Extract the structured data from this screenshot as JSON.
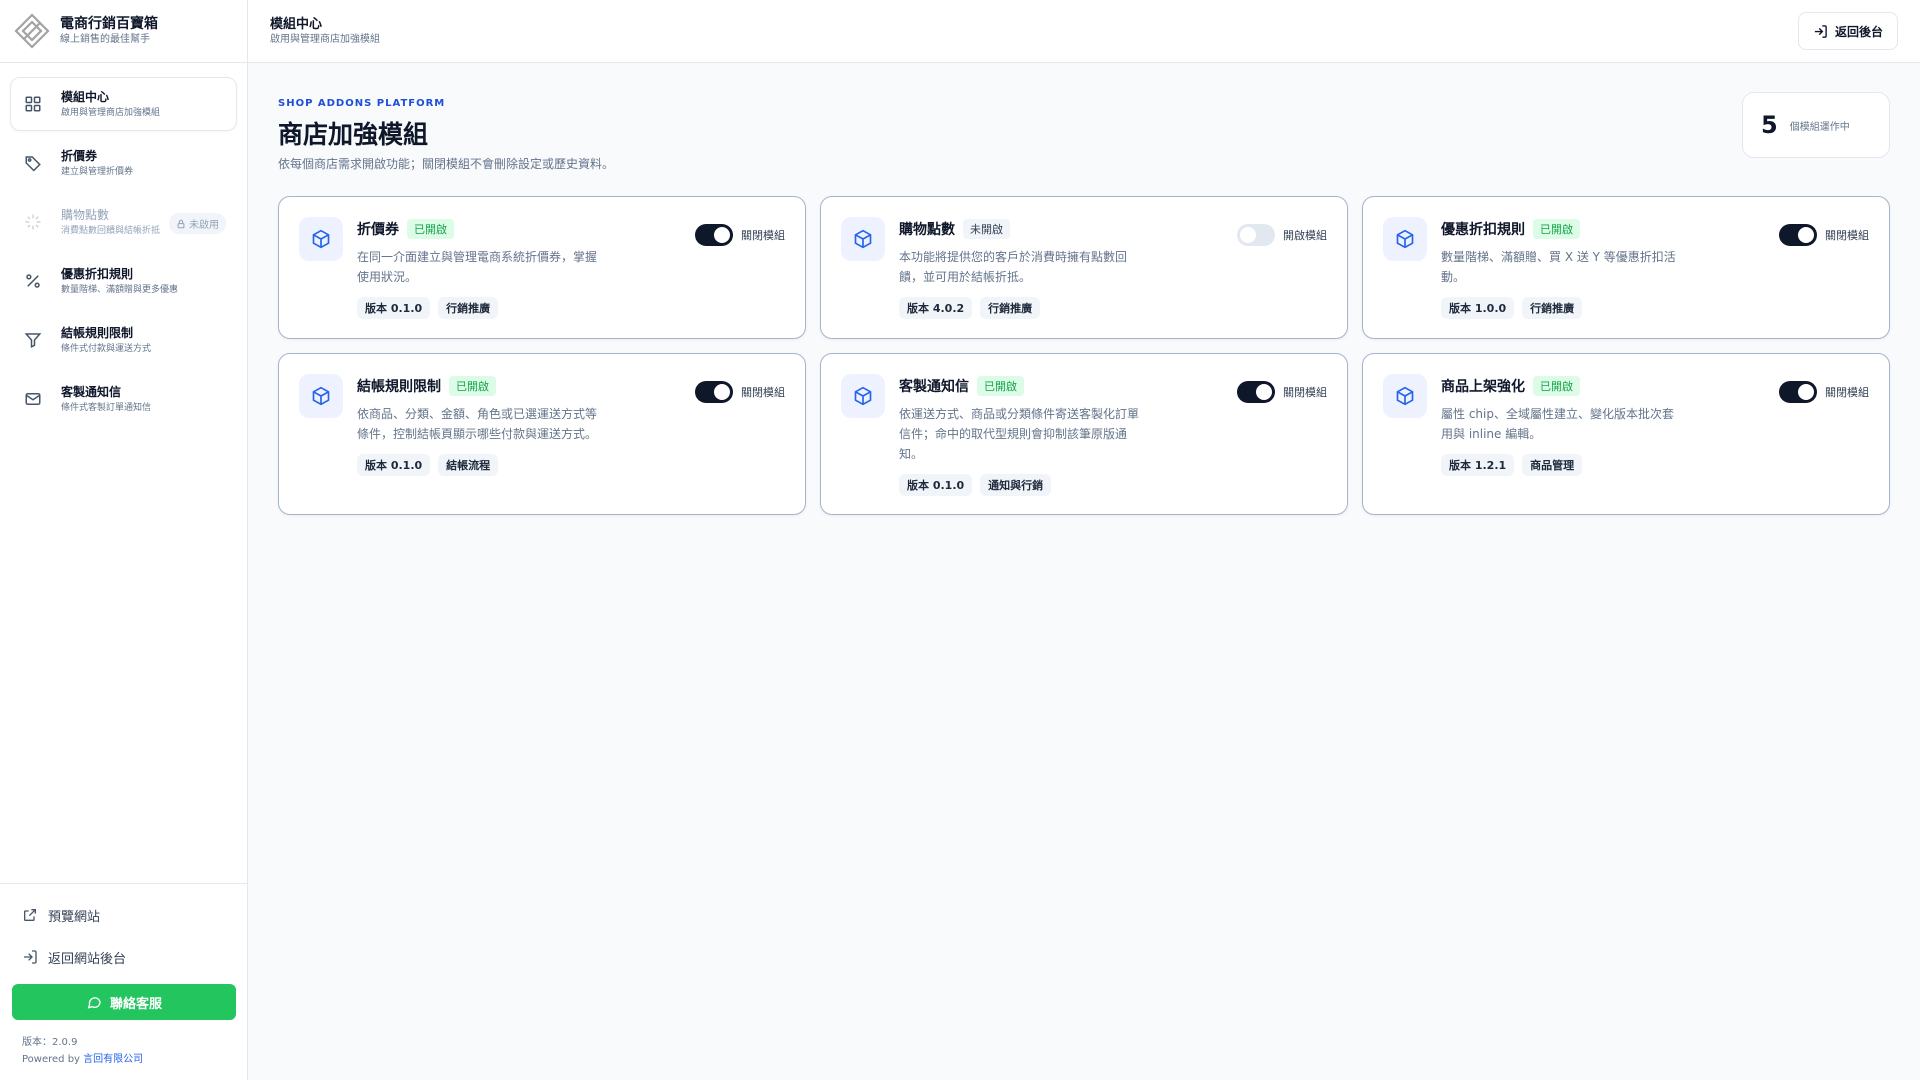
{
  "brand": {
    "title": "電商行銷百寶箱",
    "subtitle": "線上銷售的最佳幫手"
  },
  "sidebar": {
    "items": [
      {
        "label": "模組中心",
        "sub": "啟用與管理商店加強模組"
      },
      {
        "label": "折價券",
        "sub": "建立與管理折價券"
      },
      {
        "label": "購物點數",
        "sub": "消費點數回饋與結帳折抵",
        "lock": "未啟用"
      },
      {
        "label": "優惠折扣規則",
        "sub": "數量階梯、滿額贈與更多優惠"
      },
      {
        "label": "結帳規則限制",
        "sub": "條件式付款與運送方式"
      },
      {
        "label": "客製通知信",
        "sub": "條件式客製訂單通知信"
      }
    ],
    "preview": "預覽網站",
    "back": "返回網站後台",
    "contact": "聯絡客服",
    "version": "版本：2.0.9",
    "powered_prefix": "Powered by",
    "company": "言回有限公司"
  },
  "header": {
    "title": "模組中心",
    "subtitle": "啟用與管理商店加強模組",
    "back_label": "返回後台"
  },
  "hero": {
    "eyebrow": "SHOP ADDONS PLATFORM",
    "title": "商店加強模組",
    "desc": "依每個商店需求開啟功能；關閉模組不會刪除設定或歷史資料。",
    "stat_num": "5",
    "stat_label": "個模組運作中"
  },
  "modules": [
    {
      "title": "折價券",
      "status": "已開啟",
      "on": true,
      "toggle_label": "關閉模組",
      "desc": "在同一介面建立與管理電商系統折價券，掌握使用狀況。",
      "version": "版本 0.1.0",
      "category": "行銷推廣"
    },
    {
      "title": "購物點數",
      "status": "未開啟",
      "on": false,
      "toggle_label": "開啟模組",
      "desc": "本功能將提供您的客戶於消費時擁有點數回饋，並可用於結帳折抵。",
      "version": "版本 4.0.2",
      "category": "行銷推廣"
    },
    {
      "title": "優惠折扣規則",
      "status": "已開啟",
      "on": true,
      "toggle_label": "關閉模組",
      "desc": "數量階梯、滿額贈、買 X 送 Y 等優惠折扣活動。",
      "version": "版本 1.0.0",
      "category": "行銷推廣"
    },
    {
      "title": "結帳規則限制",
      "status": "已開啟",
      "on": true,
      "toggle_label": "關閉模組",
      "desc": "依商品、分類、金額、角色或已選運送方式等條件，控制結帳頁顯示哪些付款與運送方式。",
      "version": "版本 0.1.0",
      "category": "結帳流程"
    },
    {
      "title": "客製通知信",
      "status": "已開啟",
      "on": true,
      "toggle_label": "關閉模組",
      "desc": "依運送方式、商品或分類條件寄送客製化訂單信件；命中的取代型規則會抑制該筆原版通知。",
      "version": "版本 0.1.0",
      "category": "通知與行銷"
    },
    {
      "title": "商品上架強化",
      "status": "已開啟",
      "on": true,
      "toggle_label": "關閉模組",
      "desc": "屬性 chip、全域屬性建立、變化版本批次套用與 inline 編輯。",
      "version": "版本 1.2.1",
      "category": "商品管理"
    }
  ]
}
